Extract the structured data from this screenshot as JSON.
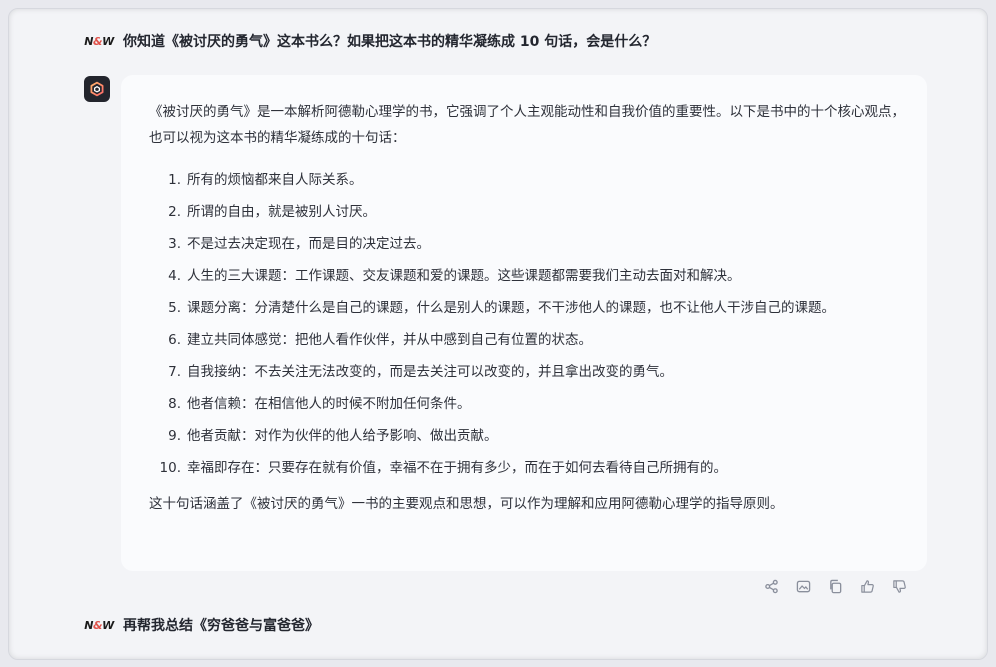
{
  "question1": {
    "avatar_left": "N",
    "avatar_mid": "&",
    "avatar_right": "W",
    "text": "你知道《被讨厌的勇气》这本书么？如果把这本书的精华凝练成 10 句话，会是什么？"
  },
  "answer": {
    "intro": "《被讨厌的勇气》是一本解析阿德勒心理学的书，它强调了个人主观能动性和自我价值的重要性。以下是书中的十个核心观点，也可以视为这本书的精华凝练成的十句话：",
    "points": [
      {
        "num": "1.",
        "text": "所有的烦恼都来自人际关系。"
      },
      {
        "num": "2.",
        "text": "所谓的自由，就是被别人讨厌。"
      },
      {
        "num": "3.",
        "text": "不是过去决定现在，而是目的决定过去。"
      },
      {
        "num": "4.",
        "text": "人生的三大课题：工作课题、交友课题和爱的课题。这些课题都需要我们主动去面对和解决。"
      },
      {
        "num": "5.",
        "text": "课题分离：分清楚什么是自己的课题，什么是别人的课题，不干涉他人的课题，也不让他人干涉自己的课题。"
      },
      {
        "num": "6.",
        "text": "建立共同体感觉：把他人看作伙伴，并从中感到自己有位置的状态。"
      },
      {
        "num": "7.",
        "text": "自我接纳：不去关注无法改变的，而是去关注可以改变的，并且拿出改变的勇气。"
      },
      {
        "num": "8.",
        "text": "他者信赖：在相信他人的时候不附加任何条件。"
      },
      {
        "num": "9.",
        "text": "他者贡献：对作为伙伴的他人给予影响、做出贡献。"
      },
      {
        "num": "10.",
        "text": "幸福即存在：只要存在就有价值，幸福不在于拥有多少，而在于如何去看待自己所拥有的。"
      }
    ],
    "outro": "这十句话涵盖了《被讨厌的勇气》一书的主要观点和思想，可以作为理解和应用阿德勒心理学的指导原则。"
  },
  "actions": {
    "icons": [
      "share-icon",
      "image-icon",
      "copy-icon",
      "thumbs-up-icon",
      "thumbs-down-icon"
    ]
  },
  "question2": {
    "avatar_left": "N",
    "avatar_mid": "&",
    "avatar_right": "W",
    "text": "再帮我总结《穷爸爸与富爸爸》"
  },
  "colors": {
    "background": "#f3f4f7",
    "bubble": "#fafbfd",
    "bot_avatar": "#23252d",
    "icon": "#8a8f9c"
  }
}
